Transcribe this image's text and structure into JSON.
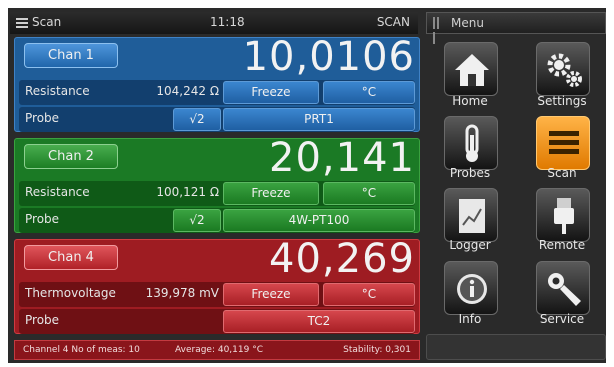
{
  "topbar": {
    "mode": "Scan",
    "time": "11:18",
    "status": "SCAN"
  },
  "menu": {
    "title": "Menu"
  },
  "channels": [
    {
      "button": "Chan 1",
      "reading": "10,0106",
      "measure_label": "Resistance",
      "measure_value": "104,242 Ω",
      "freeze": "Freeze",
      "unit": "°C",
      "probe_label": "Probe",
      "sqrt": "√2",
      "sensor": "PRT1",
      "color": "#1f5d99"
    },
    {
      "button": "Chan 2",
      "reading": "20,141",
      "measure_label": "Resistance",
      "measure_value": "100,121 Ω",
      "freeze": "Freeze",
      "unit": "°C",
      "probe_label": "Probe",
      "sqrt": "√2",
      "sensor": "4W-PT100",
      "color": "#1b7a25"
    },
    {
      "button": "Chan 4",
      "reading": "40,269",
      "measure_label": "Thermovoltage",
      "measure_value": "139,978 mV",
      "freeze": "Freeze",
      "unit": "°C",
      "probe_label": "Probe",
      "sensor": "TC2",
      "color": "#9e1c22"
    }
  ],
  "statusbar": {
    "meas": "Channel 4 No of meas: 10",
    "average": "Average: 40,119 °C",
    "stability": "Stability: 0,301"
  },
  "tiles": [
    {
      "label": "Home",
      "icon": "home-icon"
    },
    {
      "label": "Settings",
      "icon": "gear-icon"
    },
    {
      "label": "Probes",
      "icon": "thermometer-icon"
    },
    {
      "label": "Scan",
      "icon": "list-icon",
      "active": true,
      "accent": "#f08c00"
    },
    {
      "label": "Logger",
      "icon": "chart-document-icon"
    },
    {
      "label": "Remote",
      "icon": "usb-plug-icon"
    },
    {
      "label": "Info",
      "icon": "info-icon"
    },
    {
      "label": "Service",
      "icon": "wrench-icon"
    }
  ]
}
